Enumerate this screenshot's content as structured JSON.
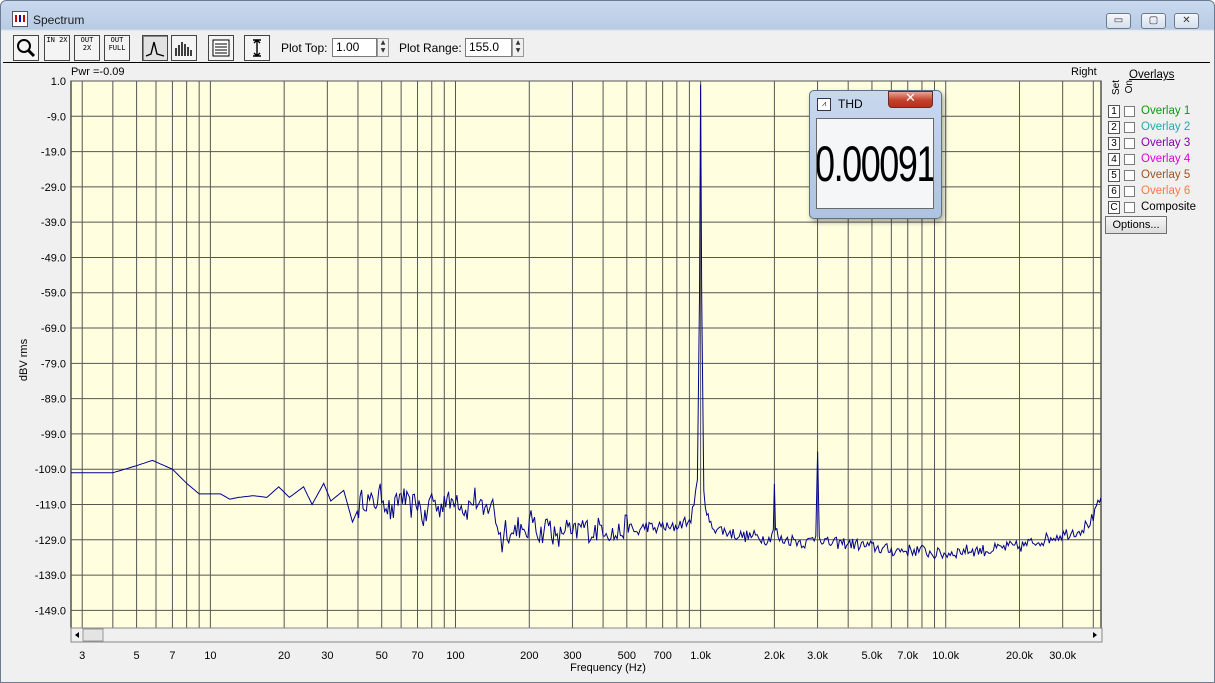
{
  "window": {
    "title": "Spectrum",
    "minimize": "▭",
    "maximize": "▢",
    "close": "✕"
  },
  "toolbar": {
    "buttons": [
      {
        "icon": "magnifier-icon",
        "label": ""
      },
      {
        "icon": "zoom-in-2x-icon",
        "label": "IN 2X"
      },
      {
        "icon": "zoom-out-2x-icon",
        "label": "OUT 2X"
      },
      {
        "icon": "zoom-out-full-icon",
        "label": "OUT FULL"
      },
      {
        "icon": "spectrum-line-icon",
        "label": ""
      },
      {
        "icon": "spectrum-bars-icon",
        "label": ""
      },
      {
        "icon": "table-view-icon",
        "label": ""
      },
      {
        "icon": "vertical-scale-icon",
        "label": ""
      }
    ],
    "plot_top_label": "Plot Top:",
    "plot_top_value": "1.00",
    "plot_range_label": "Plot Range:",
    "plot_range_value": "155.0"
  },
  "plot": {
    "pwr_text": "Pwr =-0.09",
    "channel": "Right",
    "ylabel": "dBV rms",
    "xlabel": "Frequency (Hz)",
    "background": "#ffffe0",
    "trace_color": "#00008b"
  },
  "chart_data": {
    "type": "line",
    "title": "",
    "xlabel": "Frequency (Hz)",
    "ylabel": "dBV rms",
    "x_scale": "log",
    "xlim": [
      2.7,
      43000
    ],
    "ylim": [
      -154.0,
      1.0
    ],
    "grid": true,
    "y_ticks": [
      "1.0",
      "-9.0",
      "-19.0",
      "-29.0",
      "-39.0",
      "-49.0",
      "-59.0",
      "-69.0",
      "-79.0",
      "-89.0",
      "-99.0",
      "-109.0",
      "-119.0",
      "-129.0",
      "-139.0",
      "-149.0"
    ],
    "x_ticks": [
      {
        "v": 3,
        "label": "3"
      },
      {
        "v": 5,
        "label": "5"
      },
      {
        "v": 7,
        "label": "7"
      },
      {
        "v": 10,
        "label": "10"
      },
      {
        "v": 20,
        "label": "20"
      },
      {
        "v": 30,
        "label": "30"
      },
      {
        "v": 50,
        "label": "50"
      },
      {
        "v": 70,
        "label": "70"
      },
      {
        "v": 100,
        "label": "100"
      },
      {
        "v": 200,
        "label": "200"
      },
      {
        "v": 300,
        "label": "300"
      },
      {
        "v": 500,
        "label": "500"
      },
      {
        "v": 700,
        "label": "700"
      },
      {
        "v": 1000,
        "label": "1.0k"
      },
      {
        "v": 2000,
        "label": "2.0k"
      },
      {
        "v": 3000,
        "label": "3.0k"
      },
      {
        "v": 5000,
        "label": "5.0k"
      },
      {
        "v": 7000,
        "label": "7.0k"
      },
      {
        "v": 10000,
        "label": "10.0k"
      },
      {
        "v": 20000,
        "label": "20.0k"
      },
      {
        "v": 30000,
        "label": "30.0k"
      }
    ],
    "series": [
      {
        "values": [
          [
            2.7,
            -110
          ],
          [
            3,
            -110
          ],
          [
            4,
            -110
          ],
          [
            5,
            -108
          ],
          [
            5.8,
            -106.5
          ],
          [
            7,
            -109
          ],
          [
            8,
            -113
          ],
          [
            9,
            -116
          ],
          [
            10,
            -116
          ],
          [
            11,
            -116
          ],
          [
            12,
            -117.5
          ],
          [
            13,
            -117
          ],
          [
            15,
            -116.5
          ],
          [
            17,
            -117
          ],
          [
            19,
            -114
          ],
          [
            21,
            -117
          ],
          [
            24,
            -114
          ],
          [
            26,
            -119
          ],
          [
            29,
            -113
          ],
          [
            31,
            -118
          ],
          [
            35,
            -115
          ],
          [
            38,
            -124
          ],
          [
            42,
            -117
          ],
          [
            46,
            -119
          ],
          [
            50,
            -116
          ],
          [
            55,
            -122
          ],
          [
            60,
            -116
          ],
          [
            65,
            -120
          ],
          [
            70,
            -118
          ],
          [
            75,
            -124
          ],
          [
            80,
            -116
          ],
          [
            85,
            -121
          ],
          [
            90,
            -117
          ],
          [
            95,
            -119
          ],
          [
            100,
            -116
          ],
          [
            110,
            -121
          ],
          [
            120,
            -117
          ],
          [
            130,
            -122
          ],
          [
            140,
            -118
          ],
          [
            150,
            -126
          ],
          [
            155,
            -130
          ],
          [
            160,
            -125
          ],
          [
            170,
            -128
          ],
          [
            180,
            -124
          ],
          [
            190,
            -129
          ],
          [
            200,
            -125
          ],
          [
            210,
            -122
          ],
          [
            220,
            -128
          ],
          [
            240,
            -124
          ],
          [
            260,
            -130
          ],
          [
            280,
            -125
          ],
          [
            300,
            -128
          ],
          [
            330,
            -125
          ],
          [
            360,
            -127
          ],
          [
            400,
            -125
          ],
          [
            450,
            -128
          ],
          [
            500,
            -125
          ],
          [
            550,
            -127
          ],
          [
            600,
            -125
          ],
          [
            650,
            -126
          ],
          [
            700,
            -125
          ],
          [
            750,
            -126
          ],
          [
            800,
            -125
          ],
          [
            850,
            -124
          ],
          [
            900,
            -124
          ],
          [
            940,
            -120
          ],
          [
            970,
            -112
          ],
          [
            990,
            -60
          ],
          [
            1000,
            0
          ],
          [
            1010,
            -60
          ],
          [
            1030,
            -114
          ],
          [
            1060,
            -122
          ],
          [
            1100,
            -125
          ],
          [
            1200,
            -126
          ],
          [
            1300,
            -127
          ],
          [
            1500,
            -128
          ],
          [
            1700,
            -128
          ],
          [
            1900,
            -129
          ],
          [
            1980,
            -126
          ],
          [
            2000,
            -114
          ],
          [
            2020,
            -126
          ],
          [
            2100,
            -129
          ],
          [
            2400,
            -129
          ],
          [
            2700,
            -130
          ],
          [
            2950,
            -128
          ],
          [
            3000,
            -104
          ],
          [
            3050,
            -128
          ],
          [
            3300,
            -130
          ],
          [
            4000,
            -130
          ],
          [
            5000,
            -131
          ],
          [
            6000,
            -132
          ],
          [
            7000,
            -132
          ],
          [
            8000,
            -132
          ],
          [
            9000,
            -133
          ],
          [
            10000,
            -133
          ],
          [
            12000,
            -132
          ],
          [
            15000,
            -132
          ],
          [
            18000,
            -131
          ],
          [
            20000,
            -131
          ],
          [
            22000,
            -130
          ],
          [
            25000,
            -129
          ],
          [
            28000,
            -128
          ],
          [
            32000,
            -127
          ],
          [
            36000,
            -126
          ],
          [
            40000,
            -123
          ],
          [
            43000,
            -117
          ]
        ]
      }
    ]
  },
  "overlays": {
    "title": "Overlays",
    "set_label": "Set",
    "on_label": "On",
    "items": [
      {
        "num": "1",
        "label": "Overlay 1",
        "color": "#0a9a0a"
      },
      {
        "num": "2",
        "label": "Overlay 2",
        "color": "#22aaaa"
      },
      {
        "num": "3",
        "label": "Overlay 3",
        "color": "#8800aa"
      },
      {
        "num": "4",
        "label": "Overlay 4",
        "color": "#dd00dd"
      },
      {
        "num": "5",
        "label": "Overlay 5",
        "color": "#995522"
      },
      {
        "num": "6",
        "label": "Overlay 6",
        "color": "#ff7744"
      },
      {
        "num": "C",
        "label": "Composite",
        "color": "#000000"
      }
    ],
    "options_label": "Options..."
  },
  "thd": {
    "title": "THD",
    "value": "0.00091 %",
    "close": "✕"
  }
}
